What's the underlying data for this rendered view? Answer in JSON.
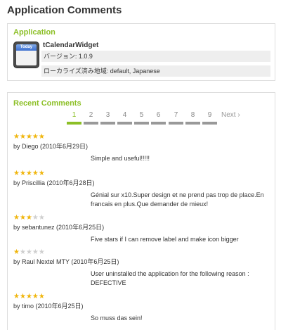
{
  "page_title": "Application Comments",
  "app_panel": {
    "title": "Application",
    "icon_label": "Today",
    "name": "tCalendarWidget",
    "version": "バージョン: 1.0.9",
    "locales": "ローカライズ済み地域: default, Japanese"
  },
  "comments_panel": {
    "title": "Recent Comments",
    "pages": [
      "1",
      "2",
      "3",
      "4",
      "5",
      "6",
      "7",
      "8",
      "9"
    ],
    "current_page": "1",
    "next_label": "Next ›",
    "comments": [
      {
        "rating": 5,
        "author": "by Diego (2010年6月29日)",
        "text": "Simple and useful!!!!!"
      },
      {
        "rating": 5,
        "author": "by Priscillia (2010年6月28日)",
        "text": "Génial sur x10.Super design et ne prend pas trop de place.En francais en plus.Que demander de mieux!"
      },
      {
        "rating": 3,
        "author": "by sebantunez (2010年6月25日)",
        "text": "Five stars if I can remove label and make icon bigger"
      },
      {
        "rating": 1,
        "author": "by Raul Nextel MTY (2010年6月25日)",
        "text": "User uninstalled the application for the following reason : DEFECTIVE"
      },
      {
        "rating": 5,
        "author": "by timo (2010年6月25日)",
        "text": "So muss das sein!"
      }
    ]
  },
  "colors": {
    "accent": "#8cbf26",
    "star": "#f0b60e",
    "star_empty": "#cfcfcf",
    "row_bg": "#eeeeee"
  }
}
